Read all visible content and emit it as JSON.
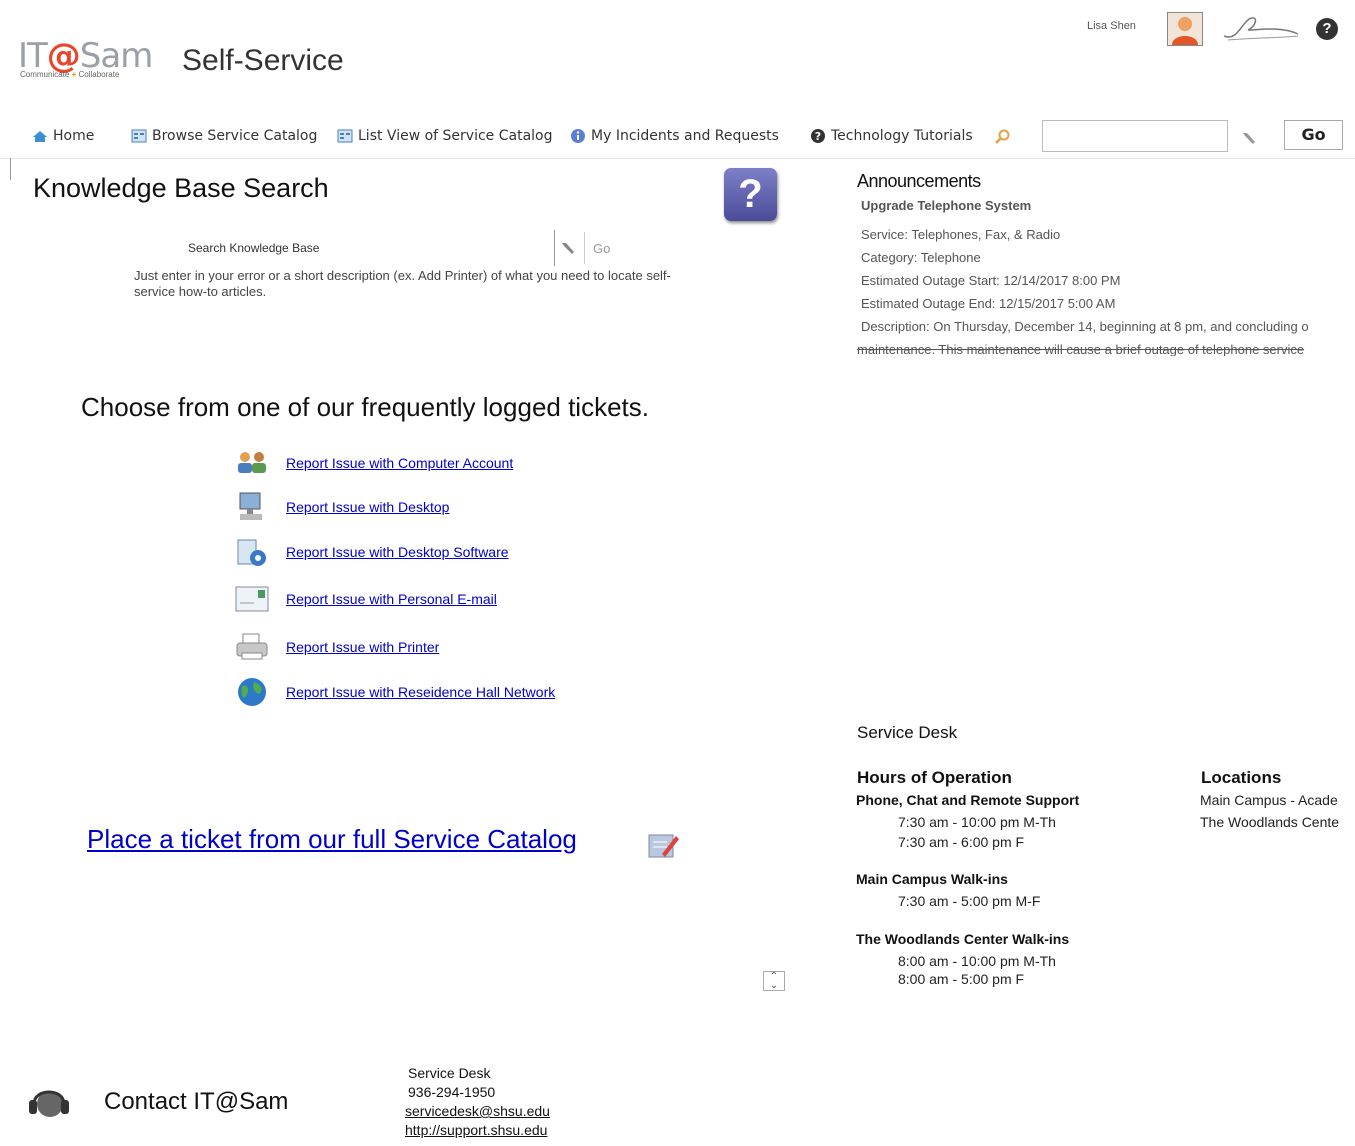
{
  "header": {
    "logo_main_prefix": "IT",
    "logo_main_at": "@",
    "logo_main_suffix": "Sam",
    "logo_sub_1": "Communicate",
    "logo_sub_plus": "+",
    "logo_sub_2": "Collaborate",
    "title": "Self-Service",
    "user_name": "Lisa Shen",
    "help_glyph": "?"
  },
  "nav": {
    "items": [
      {
        "label": "Home",
        "icon": "home-icon"
      },
      {
        "label": "Browse Service Catalog",
        "icon": "catalog-icon"
      },
      {
        "label": "List View of Service Catalog",
        "icon": "list-catalog-icon"
      },
      {
        "label": "My Incidents and Requests",
        "icon": "info-icon"
      },
      {
        "label": "Technology Tutorials",
        "icon": "help-icon"
      }
    ],
    "search_value": "",
    "go_label": "Go"
  },
  "kb": {
    "title": "Knowledge Base Search",
    "search_label": "Search Knowledge Base",
    "go_label": "Go",
    "help_text": "Just enter in your error or a short description (ex. Add Printer) of what you need to locate self-service how-to articles."
  },
  "announcements": {
    "title": "Announcements",
    "subject": "Upgrade Telephone System",
    "service": "Service: Telephones, Fax, & Radio",
    "category": "Category: Telephone",
    "start": "Estimated Outage Start: 12/14/2017 8:00 PM",
    "end": "Estimated Outage End: 12/15/2017 5:00 AM",
    "description": "Description: On Thursday, December 14, beginning at 8 pm, and concluding o",
    "description_cont": "maintenance. This maintenance will cause a brief outage of telephone service"
  },
  "tickets": {
    "heading": "Choose from one of our frequently logged tickets.",
    "items": [
      {
        "label": "Report Issue with Computer Account",
        "icon": "users-icon"
      },
      {
        "label": "Report Issue with Desktop",
        "icon": "desktop-icon"
      },
      {
        "label": "Report Issue with Desktop Software",
        "icon": "software-icon"
      },
      {
        "label": "Report Issue with Personal E-mail",
        "icon": "email-icon"
      },
      {
        "label": "Report Issue with Printer",
        "icon": "printer-icon"
      },
      {
        "label": "Report Issue with Reseidence Hall Network",
        "icon": "globe-icon"
      }
    ],
    "place_ticket": "Place a ticket from our full Service Catalog"
  },
  "service_desk": {
    "title": "Service Desk",
    "hours_heading": "Hours of Operation",
    "locations_heading": "Locations",
    "locations": [
      "Main Campus - Acade",
      "The Woodlands Cente"
    ],
    "groups": [
      {
        "name": "Phone, Chat and Remote Support",
        "times": [
          "7:30 am - 10:00 pm M-Th",
          "7:30 am - 6:00 pm F"
        ]
      },
      {
        "name": "Main Campus Walk-ins",
        "times": [
          "7:30 am - 5:00 pm M-F"
        ]
      },
      {
        "name": "The Woodlands Center Walk-ins",
        "times": [
          "8:00 am - 10:00 pm M-Th",
          "8:00 am - 5:00 pm F"
        ]
      }
    ]
  },
  "contact": {
    "title": "Contact IT@Sam",
    "desk": "Service Desk",
    "phone": "936-294-1950",
    "email": "servicedesk@shsu.edu",
    "url": "http://support.shsu.edu"
  },
  "colors": {
    "link": "#0000cc",
    "logo_at": "#e8452c",
    "kb_icon": "#5a5ba8"
  }
}
